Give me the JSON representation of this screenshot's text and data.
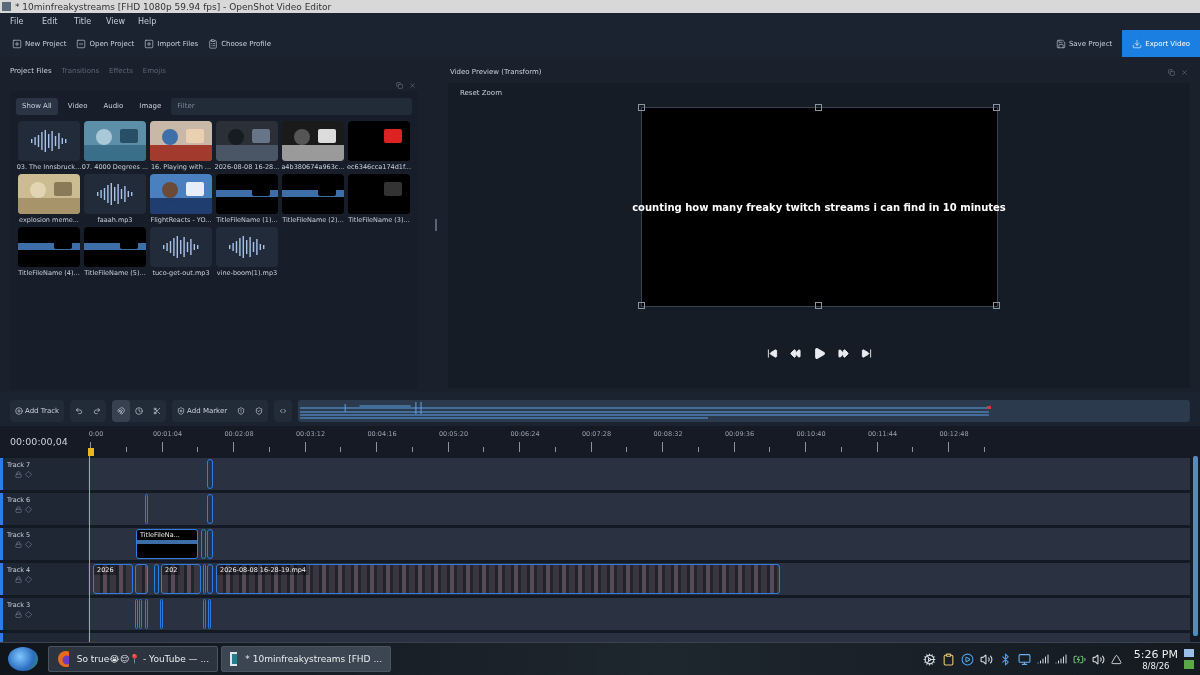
{
  "window": {
    "title": "* 10minfreakystreams [FHD 1080p 59.94 fps] - OpenShot Video Editor"
  },
  "menu": [
    "File",
    "Edit",
    "Title",
    "View",
    "Help"
  ],
  "toolbar": {
    "left": [
      {
        "label": "New Project",
        "kind": "new"
      },
      {
        "label": "Open Project",
        "kind": "open"
      },
      {
        "label": "Import Files",
        "kind": "import"
      },
      {
        "label": "Choose Profile",
        "kind": "profile"
      }
    ],
    "right": [
      {
        "label": "Save Project",
        "kind": "save",
        "primary": false
      },
      {
        "label": "Export Video",
        "kind": "export",
        "primary": true
      }
    ]
  },
  "dock_tabs": [
    {
      "label": "Project Files",
      "selected": true
    },
    {
      "label": "Transitions",
      "selected": false
    },
    {
      "label": "Effects",
      "selected": false
    },
    {
      "label": "Emojis",
      "selected": false
    }
  ],
  "filter_tabs": [
    {
      "label": "Show All",
      "selected": true
    },
    {
      "label": "Video",
      "selected": false
    },
    {
      "label": "Audio",
      "selected": false
    },
    {
      "label": "Image",
      "selected": false
    }
  ],
  "filter": {
    "placeholder": "Filter"
  },
  "files": [
    {
      "name": "03. The Innsbruck...",
      "kind": "audio"
    },
    {
      "name": "07. 4000 Degrees ...",
      "kind": "picture"
    },
    {
      "name": "16. Playing with ...",
      "kind": "picture"
    },
    {
      "name": "2026-08-08 16-28...",
      "kind": "picture"
    },
    {
      "name": "a4b380674a963c...",
      "kind": "picture"
    },
    {
      "name": "ec6346cca174d1f...",
      "kind": "picture"
    },
    {
      "name": "explosion meme...",
      "kind": "picture"
    },
    {
      "name": "faaah.mp3",
      "kind": "audio"
    },
    {
      "name": "FlightReacts - YO...",
      "kind": "picture"
    },
    {
      "name": "TitleFileName (1)...",
      "kind": "picture"
    },
    {
      "name": "TitleFileName (2)...",
      "kind": "picture"
    },
    {
      "name": "TitleFileName (3)...",
      "kind": "picture"
    },
    {
      "name": "TitleFileName (4)...",
      "kind": "picture"
    },
    {
      "name": "TitleFileName (5)...",
      "kind": "picture"
    },
    {
      "name": "tuco-get-out.mp3",
      "kind": "audio"
    },
    {
      "name": "vine-boom(1).mp3",
      "kind": "audio"
    }
  ],
  "preview": {
    "title": "Video Preview (Transform)",
    "reset_zoom": "Reset Zoom",
    "caption": "counting how many freaky twitch streams i can find in 10 minutes"
  },
  "timeline": {
    "buttons": [
      {
        "label": "Add Track",
        "kind": "add-track"
      },
      {
        "label": "Add Marker",
        "kind": "add-marker"
      }
    ],
    "snapping": true,
    "timecode": "00:00:00,04",
    "ruler": [
      "0:00",
      "00:01:04",
      "00:02:08",
      "00:03:12",
      "00:04:16",
      "00:05:20",
      "00:06:24",
      "00:07:28",
      "00:08:32",
      "00:09:36",
      "00:10:40",
      "00:11:44",
      "00:12:48"
    ],
    "tracks": [
      {
        "name": "Track 7",
        "clips": [
          {
            "kind": "sliver"
          }
        ]
      },
      {
        "name": "Track 6",
        "clips": [
          {
            "kind": "sliver"
          },
          {
            "kind": "sliver"
          }
        ]
      },
      {
        "name": "Track 5",
        "clips": [
          {
            "label": "TitleFileNa...",
            "kind": "title"
          },
          {
            "kind": "sliver"
          },
          {
            "kind": "sliver"
          }
        ]
      },
      {
        "name": "Track 4",
        "clips": [
          {
            "label": "2026",
            "kind": "video"
          },
          {
            "kind": "video"
          },
          {
            "kind": "sliver"
          },
          {
            "label": "202",
            "kind": "video"
          },
          {
            "kind": "sliver"
          },
          {
            "kind": "sliver"
          },
          {
            "label": "2026-08-08 16-28-19.mp4",
            "kind": "video"
          }
        ]
      },
      {
        "name": "Track 3",
        "clips": [
          {
            "kind": "sliver"
          },
          {
            "kind": "sliver"
          },
          {
            "kind": "sliver"
          },
          {
            "kind": "sliver"
          },
          {
            "kind": "sliver"
          },
          {
            "kind": "sliver"
          }
        ]
      }
    ]
  },
  "taskbar": {
    "tasks": [
      {
        "label": "So true😭😌📍 - YouTube — ...",
        "kind": "browser",
        "selected": false
      },
      {
        "label": "* 10minfreakystreams [FHD ...",
        "kind": "editor",
        "selected": true
      }
    ],
    "time": "5:26 PM",
    "date": "8/8/26"
  }
}
